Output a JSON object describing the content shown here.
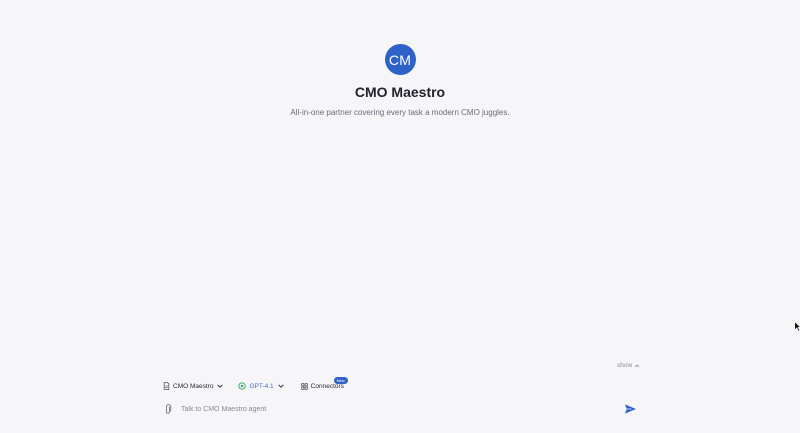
{
  "agent": {
    "initials": "CM",
    "name": "CMO Maestro",
    "description": "All-in-one partner covering every task a modern CMO juggles."
  },
  "show_toggle": {
    "label": "show"
  },
  "toolbar": {
    "agent_selector": "CMO Maestro",
    "model_selector": "GPT-4.1",
    "connectors": "Connectors",
    "connectors_badge": "New"
  },
  "composer": {
    "placeholder": "Talk to CMO Maestro agent"
  },
  "colors": {
    "background": "#f6f5f8",
    "accent": "#2f62c8",
    "model_accent": "#3b6fd6"
  },
  "icons": {
    "agent": "document-icon",
    "model": "openai-icon",
    "connectors": "grid-icon",
    "attach": "paperclip-icon",
    "send": "send-icon"
  }
}
